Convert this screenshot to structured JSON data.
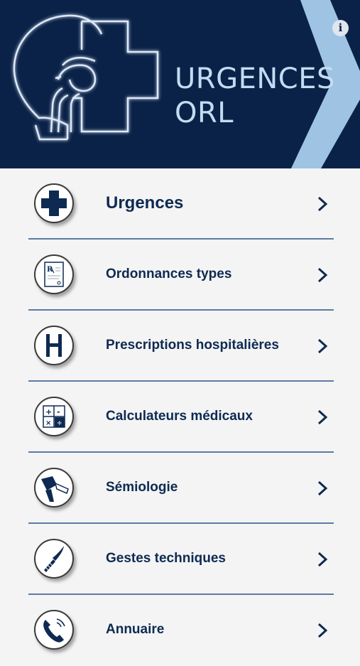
{
  "header": {
    "title_line1": "URGENCES",
    "title_line2": "ORL",
    "info_icon": "info-icon",
    "background_color": "#0b2248",
    "accent_color": "#c4dcf3"
  },
  "menu": {
    "items": [
      {
        "label": "Urgences",
        "icon": "medical-cross-icon"
      },
      {
        "label": "Ordonnances types",
        "icon": "prescription-icon"
      },
      {
        "label": "Prescriptions hospitalières",
        "icon": "hospital-icon"
      },
      {
        "label": "Calculateurs médicaux",
        "icon": "calculator-icon"
      },
      {
        "label": "Sémiologie",
        "icon": "otoscope-icon"
      },
      {
        "label": "Gestes techniques",
        "icon": "scalpel-icon"
      },
      {
        "label": "Annuaire",
        "icon": "phone-icon"
      }
    ],
    "label_color": "#0e2a52",
    "separator_color": "#5b7aa4"
  }
}
